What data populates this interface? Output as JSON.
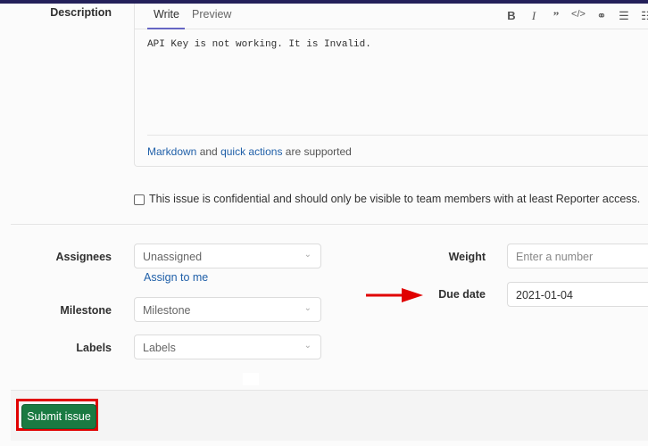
{
  "description": {
    "label": "Description",
    "tabs": [
      {
        "label": "Write",
        "active": true
      },
      {
        "label": "Preview",
        "active": false
      }
    ],
    "toolbar": [
      "bold-icon",
      "italic-icon",
      "quote-icon",
      "code-icon",
      "link-icon",
      "bullet-list-icon",
      "numbered-list-icon"
    ],
    "text": "API Key is not working. It is Invalid.",
    "hint": {
      "markdown": "Markdown",
      "and": "and",
      "quick_actions": "quick actions",
      "suffix": "are supported"
    }
  },
  "confidential": {
    "checked": false,
    "label": "This issue is confidential and should only be visible to team members with at least Reporter access."
  },
  "fields": {
    "assignees": {
      "label": "Assignees",
      "value": "Unassigned",
      "assign_to_me": "Assign to me"
    },
    "milestone": {
      "label": "Milestone",
      "value": "Milestone"
    },
    "labels": {
      "label": "Labels",
      "value": "Labels"
    },
    "weight": {
      "label": "Weight",
      "placeholder": "Enter a number"
    },
    "due_date": {
      "label": "Due date",
      "value": "2021-01-04"
    }
  },
  "footer": {
    "submit_label": "Submit issue"
  },
  "colors": {
    "primary": "#1a7a42",
    "link": "#1f5fa8",
    "annotation": "#e00000",
    "tab_accent": "#6666c4"
  }
}
